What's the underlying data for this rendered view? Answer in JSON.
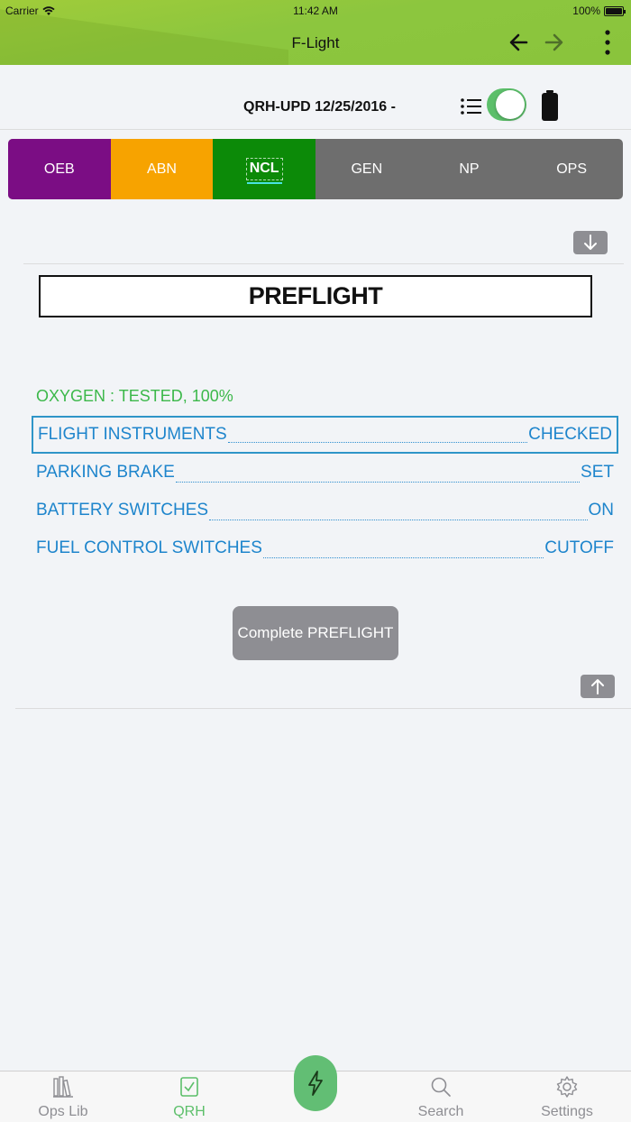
{
  "status_bar": {
    "carrier": "Carrier",
    "time": "11:42 AM",
    "battery": "100%"
  },
  "nav": {
    "title": "F-Light"
  },
  "header": {
    "document_title": "QRH-UPD 12/25/2016 -",
    "toggle_on": true
  },
  "tabs": [
    {
      "label": "OEB",
      "color": "#7b0d84"
    },
    {
      "label": "ABN",
      "color": "#f7a300"
    },
    {
      "label": "NCL",
      "color": "#0c8a08",
      "active": true
    },
    {
      "label": "GEN",
      "color": "#6e6e6e"
    },
    {
      "label": "NP",
      "color": "#6e6e6e"
    },
    {
      "label": "OPS",
      "color": "#6e6e6e"
    }
  ],
  "section": {
    "title": "PREFLIGHT",
    "note": "OXYGEN : TESTED, 100%",
    "items": [
      {
        "name": "FLIGHT INSTRUMENTS",
        "value": "CHECKED",
        "selected": true
      },
      {
        "name": "PARKING BRAKE",
        "value": "SET"
      },
      {
        "name": "BATTERY SWITCHES",
        "value": "ON"
      },
      {
        "name": "FUEL CONTROL SWITCHES",
        "value": "CUTOFF"
      }
    ],
    "complete_button": "Complete PREFLIGHT"
  },
  "bottom_tabs": [
    {
      "label": "Ops Lib",
      "icon": "library-icon"
    },
    {
      "label": "QRH",
      "icon": "checkbox-icon",
      "active": true
    },
    {
      "label": "Search",
      "icon": "search-icon"
    },
    {
      "label": "Settings",
      "icon": "gear-icon"
    }
  ],
  "colors": {
    "accent_green": "#8cc63e",
    "link_blue": "#1e85cc",
    "note_green": "#3cb84a"
  }
}
